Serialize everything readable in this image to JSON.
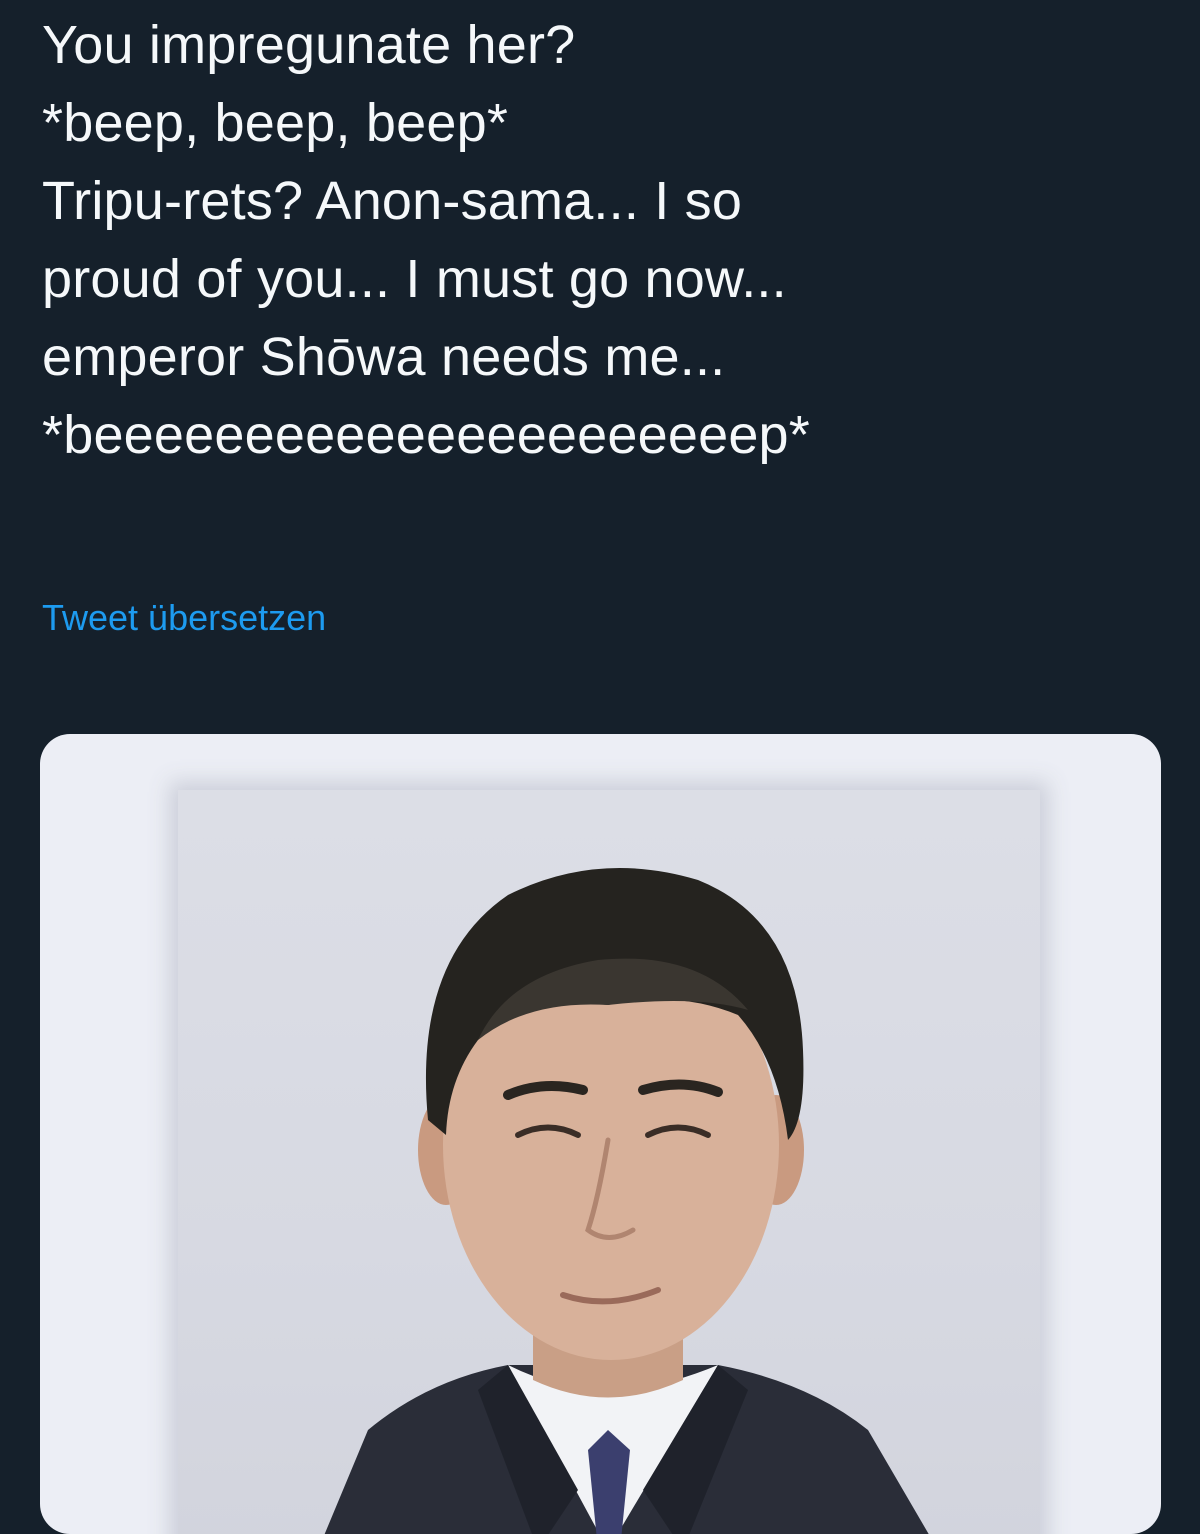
{
  "tweet": {
    "lines": [
      "You impregunate her?",
      "*beep, beep, beep*",
      "Tripu-rets? Anon-sama... I so",
      "proud of you... I must go now...",
      "emperor Shōwa needs me...",
      "*beeeeeeeeeeeeeeeeeeeeeep*"
    ],
    "translate_label": "Tweet übersetzen"
  },
  "colors": {
    "background": "#15202b",
    "text": "#f5f8fa",
    "link": "#1d9bf0",
    "card": "#eceef5"
  }
}
